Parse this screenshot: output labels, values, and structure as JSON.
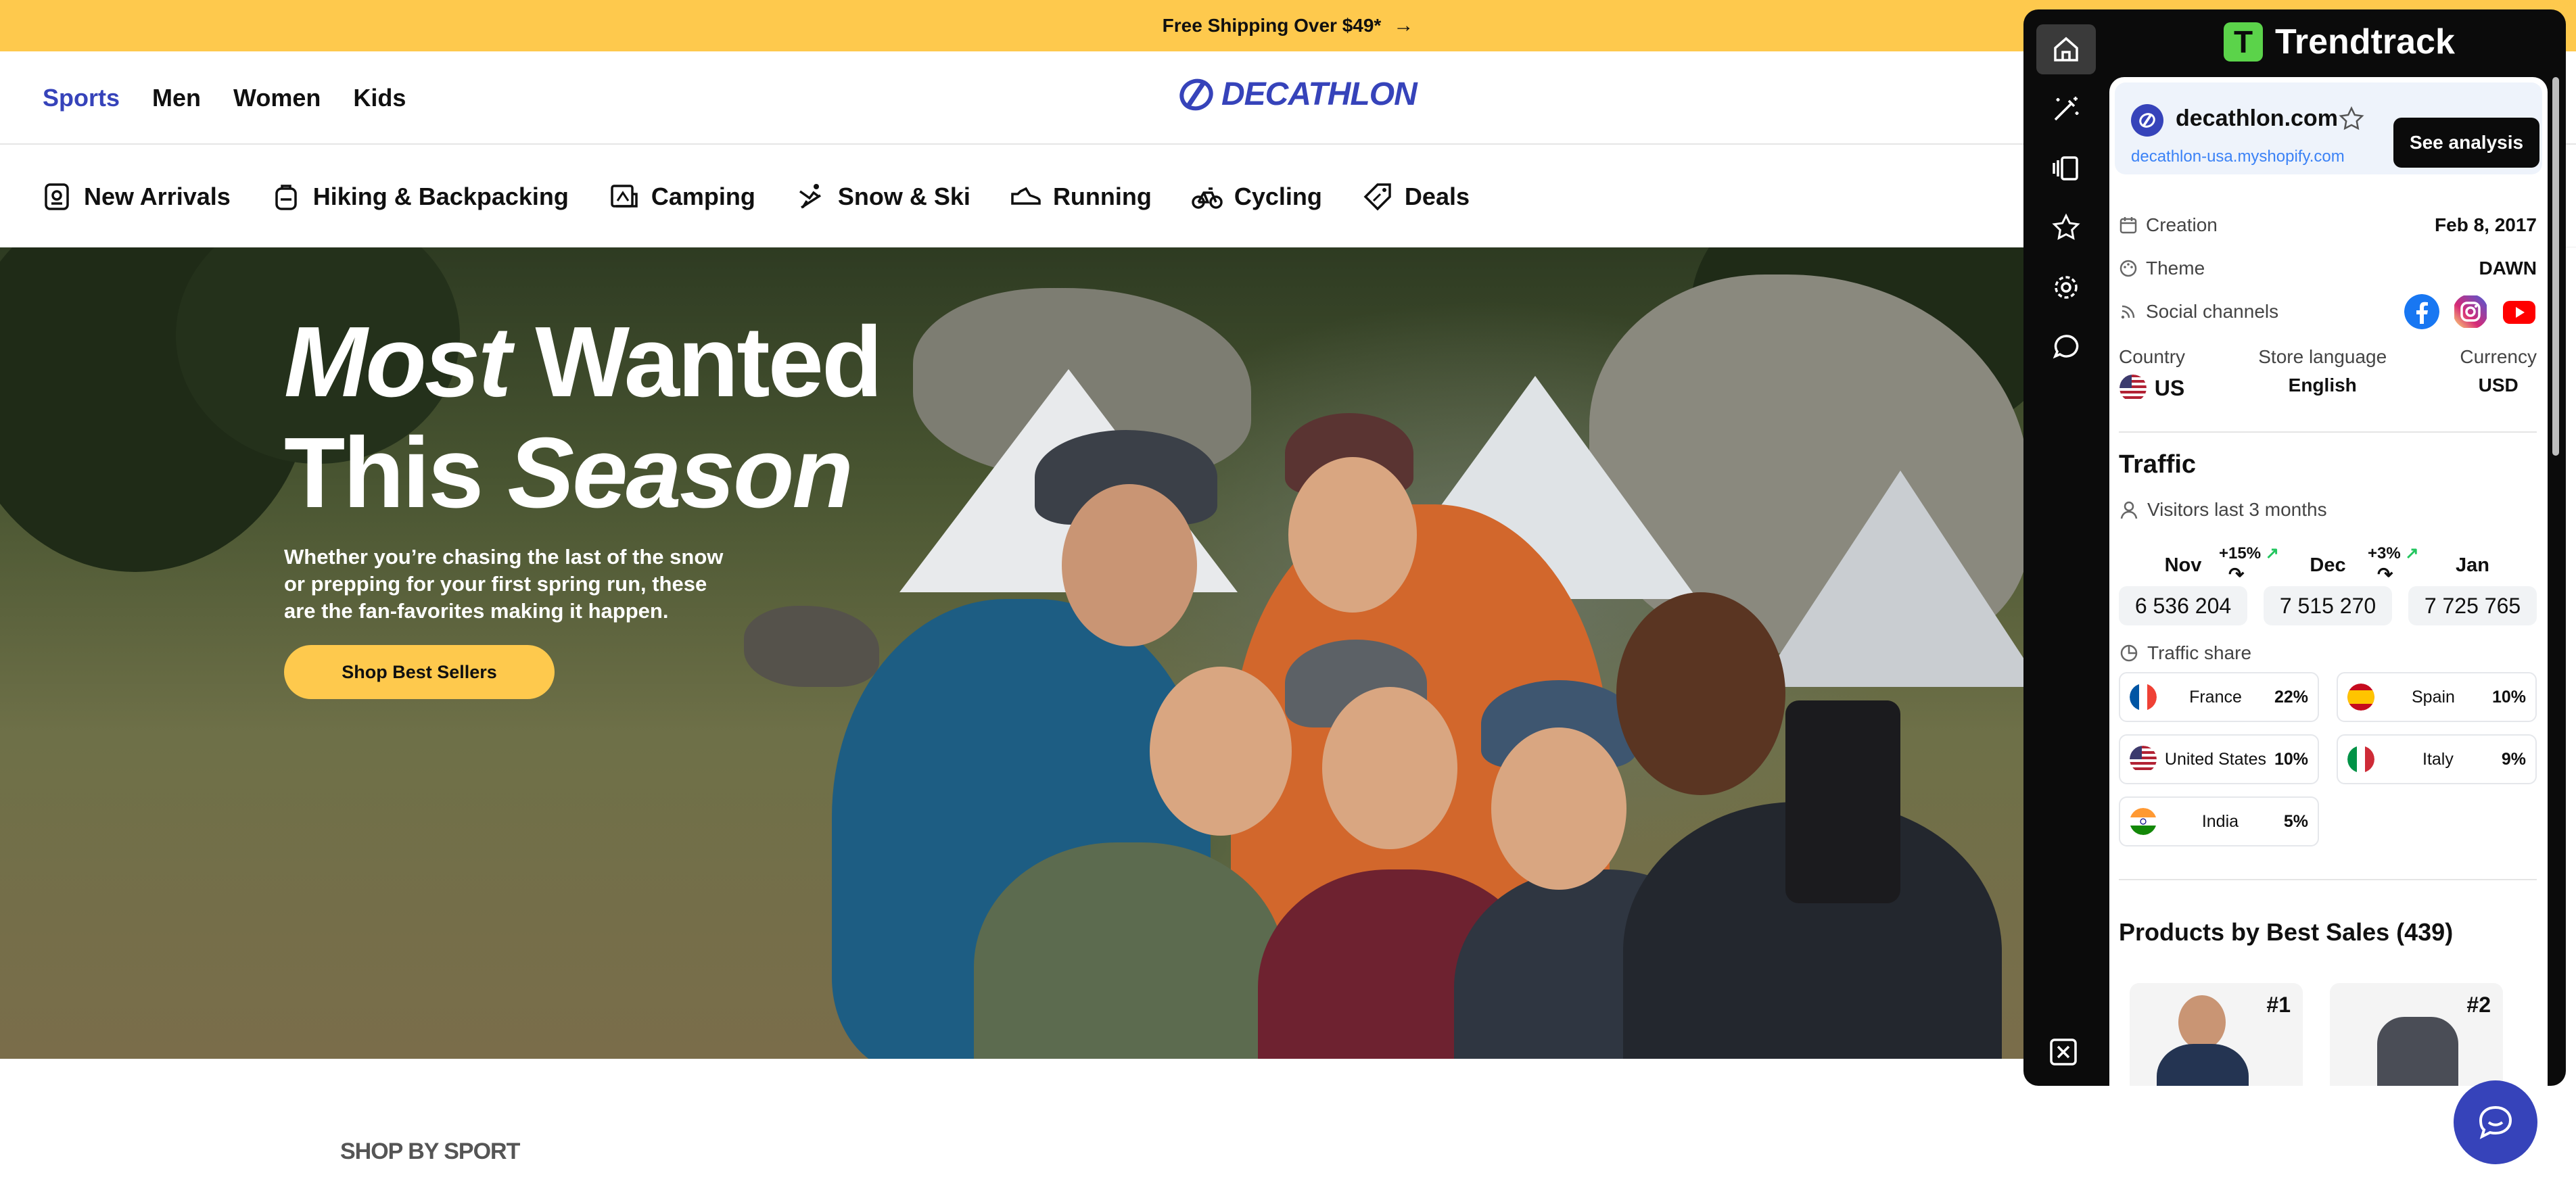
{
  "announcement": {
    "text": "Free Shipping Over $49*",
    "arrow": "→"
  },
  "header": {
    "nav": [
      "Sports",
      "Men",
      "Women",
      "Kids"
    ],
    "active_nav": "Sports",
    "logo_text": "DECATHLON"
  },
  "categories": [
    {
      "label": "New Arrivals",
      "icon": "new-arrivals-icon"
    },
    {
      "label": "Hiking & Backpacking",
      "icon": "backpack-icon"
    },
    {
      "label": "Camping",
      "icon": "camping-icon"
    },
    {
      "label": "Snow & Ski",
      "icon": "ski-icon"
    },
    {
      "label": "Running",
      "icon": "shoe-icon"
    },
    {
      "label": "Cycling",
      "icon": "bike-icon"
    },
    {
      "label": "Deals",
      "icon": "tag-icon"
    }
  ],
  "hero": {
    "title_a": "Most",
    "title_b": "Wanted",
    "title_c": "This",
    "title_d": "Season",
    "subtitle": "Whether you’re chasing the last of the snow or prepping for your first spring run, these are the fan-favorites making it happen.",
    "cta": "Shop Best Sellers"
  },
  "shop_by": "SHOP BY SPORT",
  "trendtrack": {
    "brand": "Trendtrack",
    "rail_icons": [
      "home-icon",
      "magic-wand-icon",
      "carousel-icon",
      "star-icon",
      "gear-icon",
      "chat-icon"
    ],
    "site": {
      "name": "decathlon.com",
      "url": "decathlon-usa.myshopify.com",
      "cta": "See analysis"
    },
    "info": {
      "creation_label": "Creation",
      "creation_value": "Feb 8, 2017",
      "theme_label": "Theme",
      "theme_value": "DAWN",
      "social_label": "Social channels"
    },
    "meta": {
      "country_label": "Country",
      "country_value": "US",
      "language_label": "Store language",
      "language_value": "English",
      "currency_label": "Currency",
      "currency_value": "USD"
    },
    "traffic": {
      "title": "Traffic",
      "visitors_label": "Visitors last 3 months",
      "months": [
        {
          "month": "Nov",
          "visitors": "6 536 204"
        },
        {
          "month": "Dec",
          "visitors": "7 515 270"
        },
        {
          "month": "Jan",
          "visitors": "7 725 765"
        }
      ],
      "growth": [
        "+15%",
        "+3%"
      ],
      "share_label": "Traffic share",
      "share": [
        {
          "country": "France",
          "pct": "22%"
        },
        {
          "country": "Spain",
          "pct": "10%"
        },
        {
          "country": "United States",
          "pct": "10%"
        },
        {
          "country": "Italy",
          "pct": "9%"
        },
        {
          "country": "India",
          "pct": "5%"
        }
      ]
    },
    "products": {
      "title": "Products by Best Sales (439)",
      "ranks": [
        "#1",
        "#2"
      ]
    }
  },
  "colors": {
    "accent": "#3643ba",
    "yellow": "#fec94d",
    "green": "#5bd34a"
  }
}
